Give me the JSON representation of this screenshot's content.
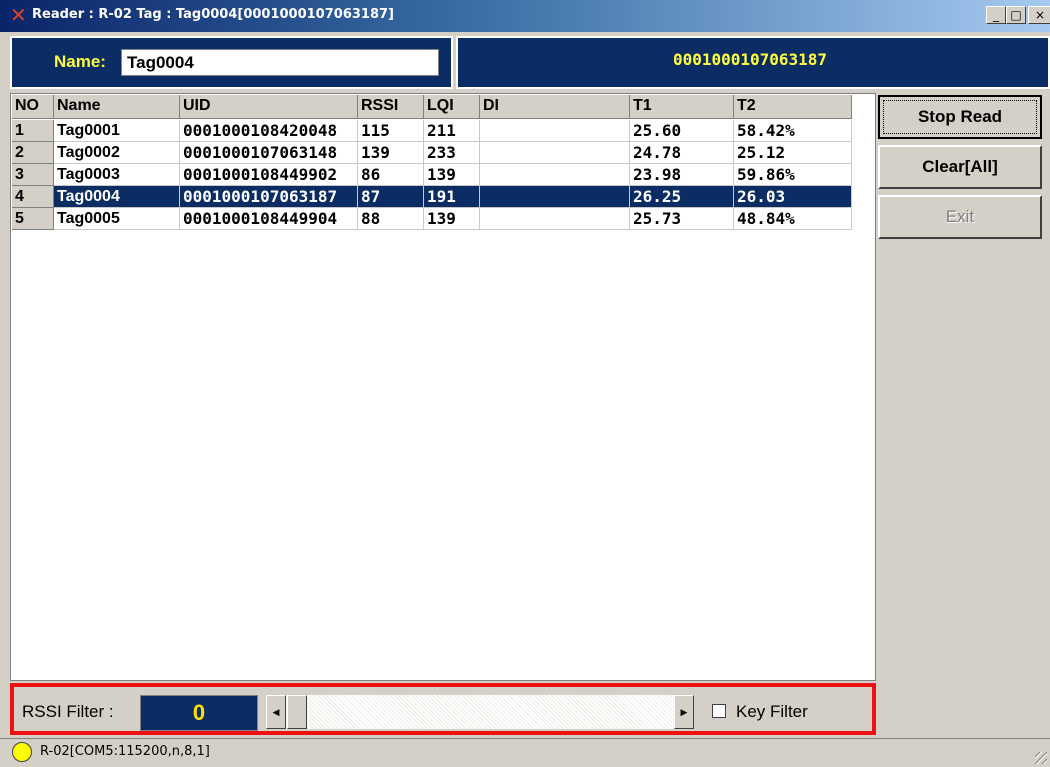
{
  "window": {
    "title": "Reader : R-02  Tag : Tag0004[0001000107063187]",
    "min_label": "_",
    "max_label": "□",
    "close_label": "×"
  },
  "header": {
    "name_label": "Name:",
    "name_value": "Tag0004",
    "uid": "0001000107063187"
  },
  "table": {
    "columns": [
      "NO",
      "Name",
      "UID",
      "RSSI",
      "LQI",
      "DI",
      "T1",
      "T2"
    ],
    "selected_row": 3,
    "rows": [
      {
        "no": "1",
        "name": "Tag0001",
        "uid": "0001000108420048",
        "rssi": "115",
        "lqi": "211",
        "di": "",
        "t1": "25.60",
        "t2": "58.42%"
      },
      {
        "no": "2",
        "name": "Tag0002",
        "uid": "0001000107063148",
        "rssi": "139",
        "lqi": "233",
        "di": "",
        "t1": "24.78",
        "t2": "25.12"
      },
      {
        "no": "3",
        "name": "Tag0003",
        "uid": "0001000108449902",
        "rssi": "86",
        "lqi": "139",
        "di": "",
        "t1": "23.98",
        "t2": "59.86%"
      },
      {
        "no": "4",
        "name": "Tag0004",
        "uid": "0001000107063187",
        "rssi": "87",
        "lqi": "191",
        "di": "",
        "t1": "26.25",
        "t2": "26.03"
      },
      {
        "no": "5",
        "name": "Tag0005",
        "uid": "0001000108449904",
        "rssi": "88",
        "lqi": "139",
        "di": "",
        "t1": "25.73",
        "t2": "48.84%"
      }
    ]
  },
  "buttons": {
    "stop_read": "Stop Read",
    "clear_all": "Clear[All]",
    "exit": "Exit"
  },
  "filter": {
    "rssi_label": "RSSI Filter :",
    "rssi_value": "0",
    "key_filter_label": "Key Filter",
    "key_filter_checked": false
  },
  "status": {
    "text": "R-02[COM5:115200,n,8,1]",
    "led_color": "#ffff00"
  },
  "colors": {
    "selection": "#0b2d63",
    "highlight_text": "#ffff40",
    "filter_frame": "#ee1111"
  }
}
